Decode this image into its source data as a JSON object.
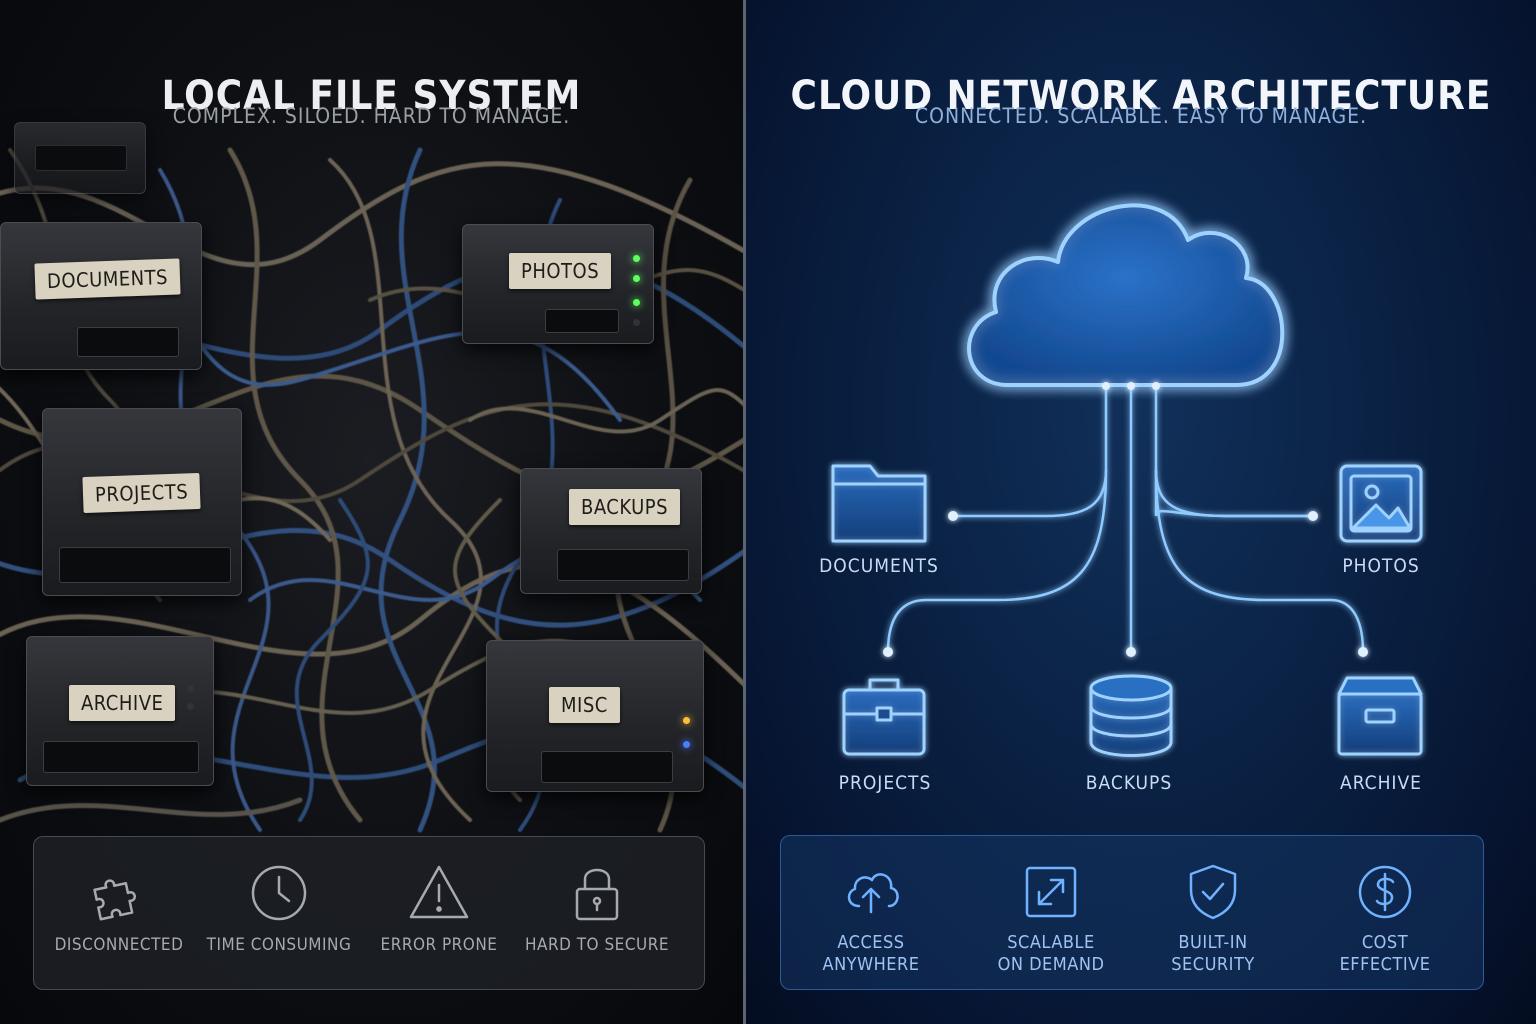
{
  "left": {
    "title": "LOCAL FILE SYSTEM",
    "subtitle": "COMPLEX. SILOED. HARD TO MANAGE.",
    "boxes": [
      {
        "label": "DOCUMENTS"
      },
      {
        "label": "PHOTOS"
      },
      {
        "label": "PROJECTS"
      },
      {
        "label": "BACKUPS"
      },
      {
        "label": "ARCHIVE"
      },
      {
        "label": "MISC"
      }
    ],
    "features": [
      {
        "icon": "puzzle-icon",
        "label": "DISCONNECTED"
      },
      {
        "icon": "clock-icon",
        "label": "TIME CONSUMING"
      },
      {
        "icon": "warning-icon",
        "label": "ERROR PRONE"
      },
      {
        "icon": "lock-icon",
        "label": "HARD TO SECURE"
      }
    ]
  },
  "right": {
    "title": "CLOUD NETWORK ARCHITECTURE",
    "subtitle": "CONNECTED. SCALABLE. EASY TO MANAGE.",
    "nodes": [
      {
        "icon": "folder-icon",
        "label": "DOCUMENTS"
      },
      {
        "icon": "image-icon",
        "label": "PHOTOS"
      },
      {
        "icon": "briefcase-icon",
        "label": "PROJECTS"
      },
      {
        "icon": "database-icon",
        "label": "BACKUPS"
      },
      {
        "icon": "archive-box-icon",
        "label": "ARCHIVE"
      }
    ],
    "features": [
      {
        "icon": "cloud-upload-icon",
        "line1": "ACCESS",
        "line2": "ANYWHERE"
      },
      {
        "icon": "expand-icon",
        "line1": "SCALABLE",
        "line2": "ON DEMAND"
      },
      {
        "icon": "shield-check-icon",
        "line1": "BUILT-IN",
        "line2": "SECURITY"
      },
      {
        "icon": "dollar-icon",
        "line1": "COST",
        "line2": "EFFECTIVE"
      }
    ]
  },
  "colors": {
    "glow": "#7fc0ff",
    "left_bg": "#0d0f13",
    "right_bg": "#0a2143",
    "label_paper": "#d9d2c0"
  }
}
